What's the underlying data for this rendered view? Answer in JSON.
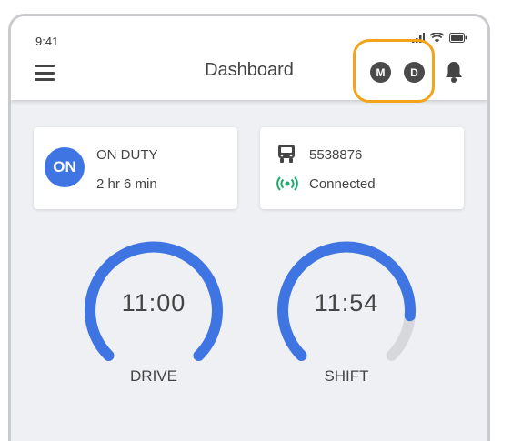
{
  "status_bar": {
    "time": "9:41"
  },
  "header": {
    "title": "Dashboard",
    "badge_m": "M",
    "badge_d": "D"
  },
  "duty_card": {
    "badge": "ON",
    "status": "ON DUTY",
    "duration": "2 hr 6 min"
  },
  "vehicle_card": {
    "vehicle_id": "5538876",
    "connection": "Connected"
  },
  "gauges": [
    {
      "value": "11:00",
      "label": "DRIVE",
      "fraction": 1.0
    },
    {
      "value": "11:54",
      "label": "SHIFT",
      "fraction": 0.85
    }
  ],
  "colors": {
    "accent": "#3f74e3",
    "highlight": "#f5a31a",
    "connected": "#1fa86b",
    "track": "#d6d8db"
  }
}
